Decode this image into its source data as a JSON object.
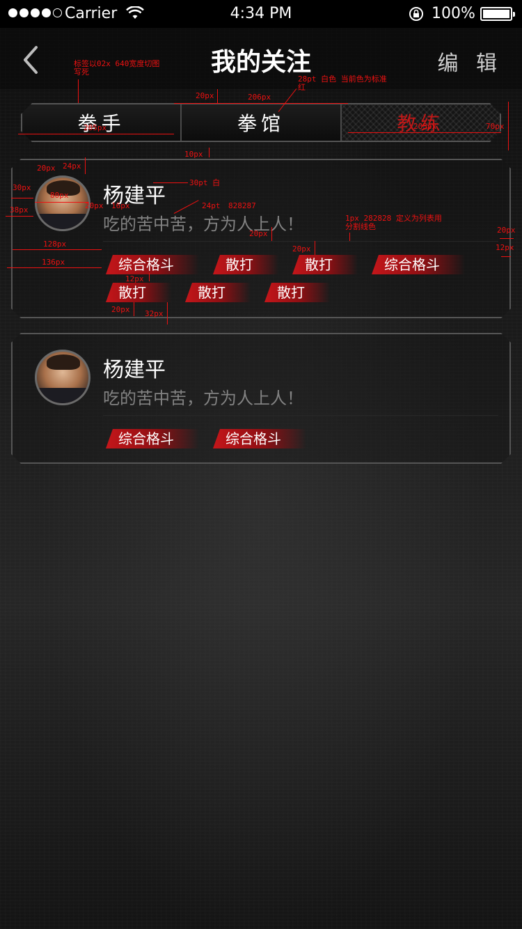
{
  "status_bar": {
    "carrier": "Carrier",
    "time": "4:34 PM",
    "battery": "100%"
  },
  "nav": {
    "title": "我的关注",
    "edit": "编 辑"
  },
  "tabs": [
    {
      "label": "拳手",
      "active": false
    },
    {
      "label": "拳馆",
      "active": false
    },
    {
      "label": "教练",
      "active": true
    }
  ],
  "cards": [
    {
      "name": "杨建平",
      "motto": "吃的苦中苦，方为人上人！",
      "tags": [
        "综合格斗",
        "散打",
        "散打",
        "综合格斗",
        "散打",
        "散打",
        "散打"
      ]
    },
    {
      "name": "杨建平",
      "motto": "吃的苦中苦，方为人上人！",
      "tags": [
        "综合格斗",
        "综合格斗"
      ]
    }
  ],
  "annotations": {
    "a1": "标签以02x 640宽度切图",
    "a1b": "写死",
    "a2": "28pt 白色 当前色为标准",
    "a2b": "红",
    "a3": "20px",
    "a4": "206px",
    "a5": "205px",
    "a6": "205px",
    "a7": "70px",
    "a8": "10px",
    "a9": "20px",
    "a10": "24px",
    "a11": "30pt 白",
    "a12": "30px",
    "a13": "80px",
    "a14": "38px",
    "a15": "20px",
    "a16": "16px",
    "a17": "24pt",
    "a17b": "828287",
    "a18": "1px 282828 定义为列表用",
    "a18b": "分割线色",
    "a19": "20px",
    "a20": "20px",
    "a21": "20px",
    "a22": "12px",
    "a23": "128px",
    "a24": "136px",
    "a25": "12px",
    "a26": "20px",
    "a27": "32px"
  },
  "colors": {
    "accent_red": "#c01818",
    "tag_red": "#c4161a",
    "motto_gray": "#828282",
    "divider": "#282828",
    "border": "#555555"
  }
}
